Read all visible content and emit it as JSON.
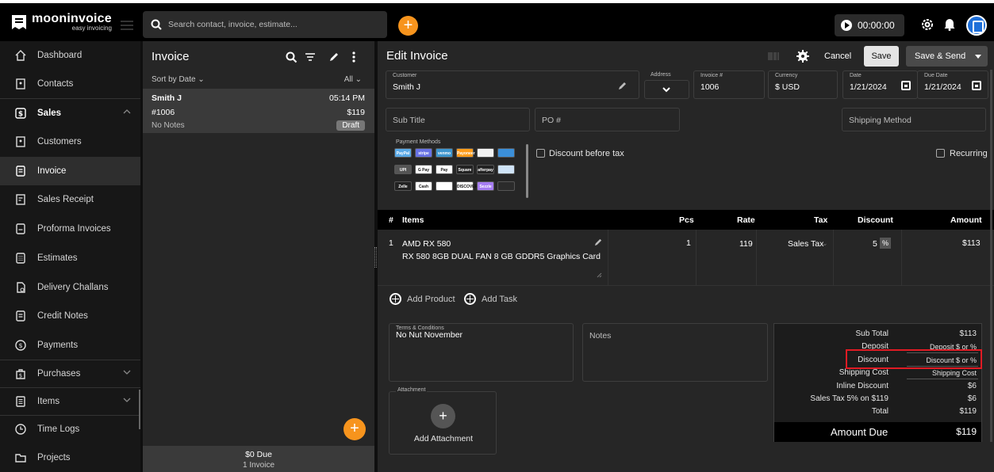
{
  "app": {
    "logo_title": "mooninvoice",
    "logo_subtitle": "easy invoicing",
    "search_placeholder": "Search contact, invoice, estimate...",
    "timer": "00:00:00"
  },
  "sidebar": {
    "items": [
      {
        "label": "Dashboard",
        "icon": "home-icon"
      },
      {
        "label": "Contacts",
        "icon": "contacts-icon"
      },
      {
        "label": "Sales",
        "icon": "sales-icon"
      },
      {
        "label": "Customers",
        "icon": "customers-icon"
      },
      {
        "label": "Invoice",
        "icon": "invoice-icon"
      },
      {
        "label": "Sales Receipt",
        "icon": "receipt-icon"
      },
      {
        "label": "Proforma Invoices",
        "icon": "proforma-icon"
      },
      {
        "label": "Estimates",
        "icon": "estimates-icon"
      },
      {
        "label": "Delivery Challans",
        "icon": "delivery-icon"
      },
      {
        "label": "Credit Notes",
        "icon": "credit-notes-icon"
      },
      {
        "label": "Payments",
        "icon": "payments-icon"
      },
      {
        "label": "Purchases",
        "icon": "purchases-icon"
      },
      {
        "label": "Items",
        "icon": "items-icon"
      },
      {
        "label": "Time Logs",
        "icon": "clock-icon"
      },
      {
        "label": "Projects",
        "icon": "folder-icon"
      }
    ]
  },
  "list": {
    "title": "Invoice",
    "sort_label": "Sort by Date",
    "filter_label": "All",
    "invoice": {
      "name": "Smith J",
      "time": "05:14 PM",
      "number": "#1006",
      "amount": "$119",
      "notes": "No Notes",
      "status": "Draft"
    },
    "footer_due": "$0  Due",
    "footer_count": "1 Invoice"
  },
  "editor": {
    "title": "Edit Invoice",
    "cancel_label": "Cancel",
    "save_label": "Save",
    "save_send_label": "Save & Send",
    "customer_label": "Customer",
    "customer_value": "Smith J",
    "address_label": "Address",
    "invoice_no_label": "Invoice #",
    "invoice_no_value": "1006",
    "currency_label": "Currency",
    "currency_value": "$ USD",
    "date_label": "Date",
    "date_value": "1/21/2024",
    "due_date_label": "Due Date",
    "due_date_value": "1/21/2024",
    "subtitle_placeholder": "Sub Title",
    "po_placeholder": "PO #",
    "shipping_method_placeholder": "Shipping Method",
    "payment_methods_label": "Payment Methods",
    "payment_badges": [
      {
        "label": "PayPal",
        "color": "#5aa9e6"
      },
      {
        "label": "stripe",
        "color": "#6772e5"
      },
      {
        "label": "venmo",
        "color": "#3d95ce"
      },
      {
        "label": "Payoneer",
        "color": "#ff9c1a"
      },
      {
        "label": "",
        "color": "#f2f2f2"
      },
      {
        "label": "",
        "color": "#3b8fd9"
      },
      {
        "label": "UPI",
        "color": "#555555"
      },
      {
        "label": "G Pay",
        "color": "#ffffff"
      },
      {
        "label": "Pay",
        "color": "#ffffff"
      },
      {
        "label": "Square",
        "color": "#222222"
      },
      {
        "label": "afterpay",
        "color": "#222222"
      },
      {
        "label": "",
        "color": "#cfe3f7"
      },
      {
        "label": "Zelle",
        "color": "#222222"
      },
      {
        "label": "Cash",
        "color": "#ffffff"
      },
      {
        "label": "",
        "color": "#ffffff"
      },
      {
        "label": "DISCOVER",
        "color": "#ffffff"
      },
      {
        "label": "Sezzle",
        "color": "#a57cf1"
      },
      {
        "label": "",
        "color": "#2b2b2b"
      }
    ],
    "discount_before_tax_label": "Discount before tax",
    "recurring_label": "Recurring"
  },
  "table": {
    "headers": {
      "num": "#",
      "items": "Items",
      "pcs": "Pcs",
      "rate": "Rate",
      "tax": "Tax",
      "discount": "Discount",
      "amount": "Amount"
    },
    "rows": [
      {
        "num": "1",
        "name": "AMD RX 580",
        "description": "RX 580 8GB DUAL FAN 8 GB GDDR5 Graphics Card",
        "pcs": "1",
        "rate": "119",
        "tax": "Sales Tax",
        "discount": "5",
        "discount_unit": "%",
        "amount": "$113"
      }
    ],
    "add_product_label": "Add Product",
    "add_task_label": "Add Task"
  },
  "bottom": {
    "terms_label": "Terms & Conditions",
    "terms_value": "No Nut November",
    "notes_placeholder": "Notes",
    "attachment_label": "Attachment",
    "add_attachment_label": "Add Attachment"
  },
  "totals": {
    "subtotal_label": "Sub Total",
    "subtotal_value": "$113",
    "deposit_label": "Deposit",
    "deposit_value": "Deposit $ or %",
    "discount_label": "Discount",
    "discount_value": "Discount $ or %",
    "shipping_label": "Shipping Cost",
    "shipping_value": "Shipping Cost",
    "inline_discount_label": "Inline Discount",
    "inline_discount_value": "$6",
    "sales_tax_label": "Sales Tax 5% on $119",
    "sales_tax_value": "$6",
    "total_label": "Total",
    "total_value": "$119",
    "amount_due_label": "Amount Due",
    "amount_due_value": "$119"
  },
  "colors": {
    "accent": "#f7941d",
    "highlight": "#e01b24",
    "avatar": "#1e6fd9"
  }
}
